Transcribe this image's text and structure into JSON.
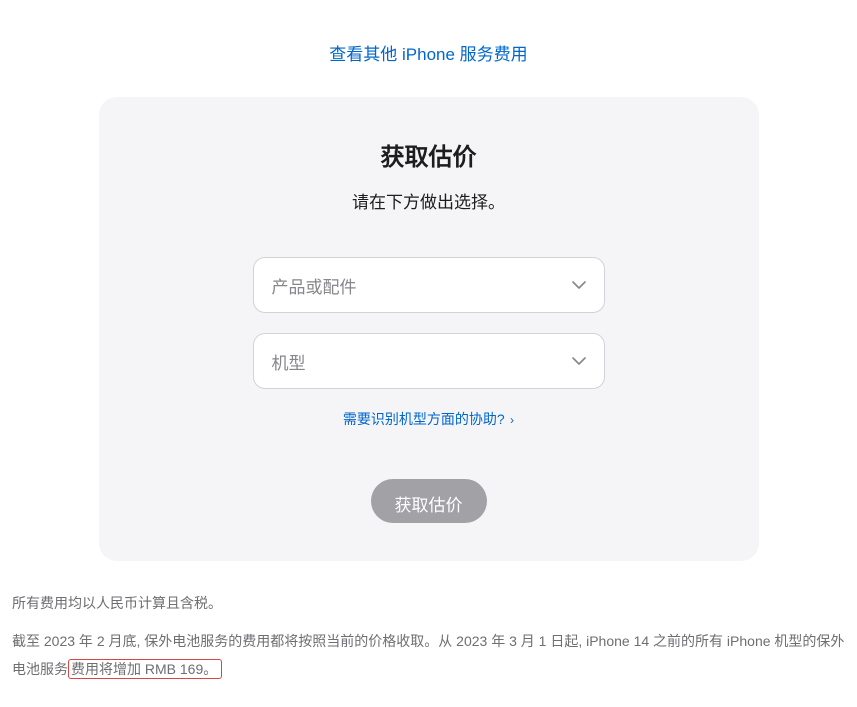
{
  "topLink": "查看其他 iPhone 服务费用",
  "card": {
    "title": "获取估价",
    "subtitle": "请在下方做出选择。",
    "select1Placeholder": "产品或配件",
    "select2Placeholder": "机型",
    "helpLinkText": "需要识别机型方面的协助?",
    "submitLabel": "获取估价"
  },
  "footer": {
    "line1": "所有费用均以人民币计算且含税。",
    "line2_prefix": "截至 2023 年 2 月底, 保外电池服务的费用都将按照当前的价格收取。从 2023 年 3 月 1 日起, iPhone 14 之前的所有 iPhone 机型的保外电池服务",
    "line2_highlight": "费用将增加 RMB 169。"
  }
}
